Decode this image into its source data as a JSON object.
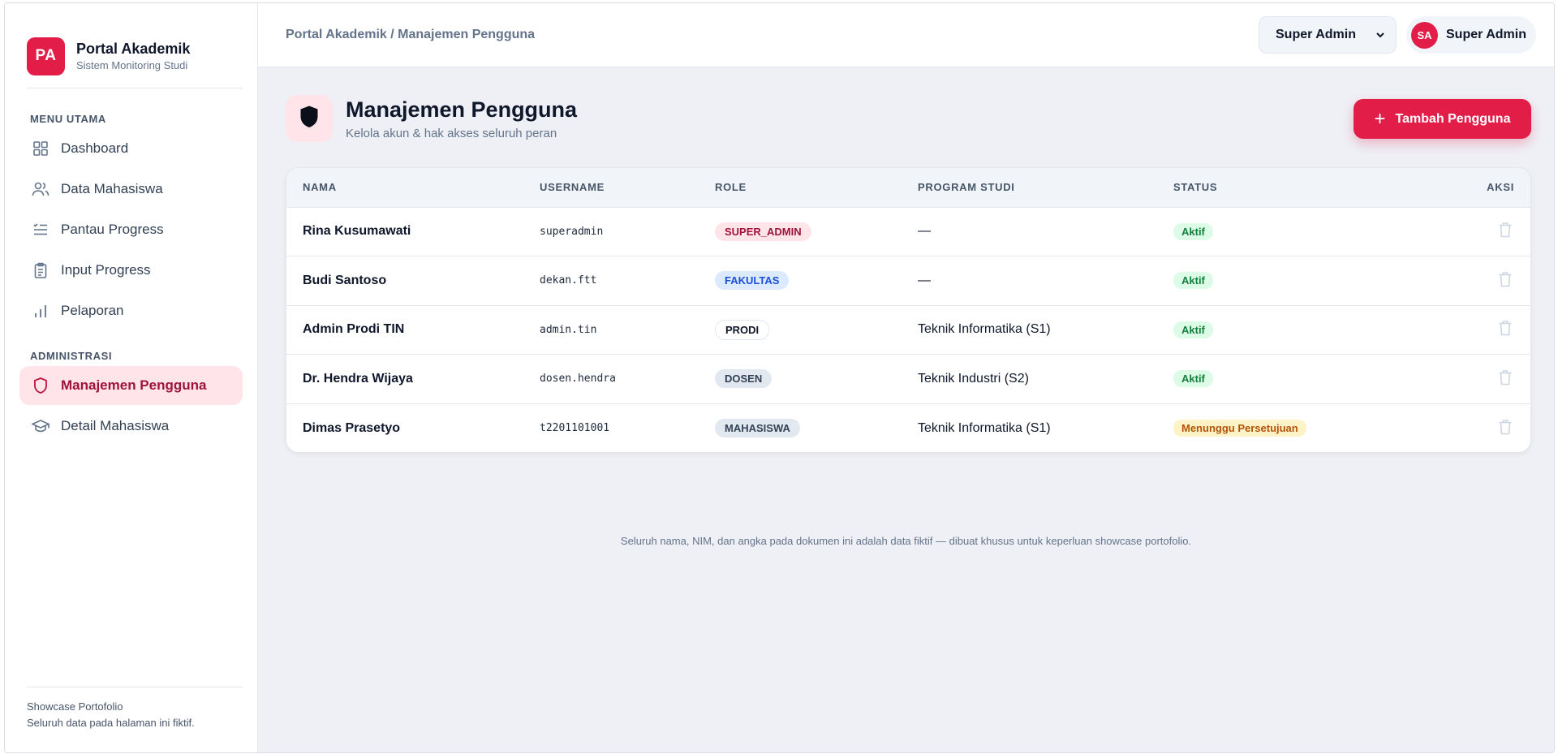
{
  "brand": {
    "logo": "PA",
    "title": "Portal Akademik",
    "subtitle": "Sistem Monitoring Studi"
  },
  "sidebar": {
    "section1": "MENU UTAMA",
    "items1": [
      {
        "label": "Dashboard",
        "icon": "grid-icon"
      },
      {
        "label": "Data Mahasiswa",
        "icon": "users-icon"
      },
      {
        "label": "Pantau Progress",
        "icon": "list-check-icon"
      },
      {
        "label": "Input Progress",
        "icon": "clipboard-icon"
      },
      {
        "label": "Pelaporan",
        "icon": "bar-chart-icon"
      }
    ],
    "section2": "ADMINISTRASI",
    "items2": [
      {
        "label": "Manajemen Pengguna",
        "icon": "shield-icon",
        "active": true
      },
      {
        "label": "Detail Mahasiswa",
        "icon": "graduation-cap-icon"
      }
    ],
    "footer_line1": "Showcase Portofolio",
    "footer_line2": "Seluruh data pada halaman ini fiktif."
  },
  "topbar": {
    "breadcrumb": "Portal Akademik / Manajemen Pengguna",
    "role_selected": "Super Admin",
    "avatar": "SA",
    "user_name": "Super Admin"
  },
  "page": {
    "title": "Manajemen Pengguna",
    "subtitle": "Kelola akun & hak akses seluruh peran",
    "add_button": "Tambah Pengguna"
  },
  "table": {
    "columns": [
      "NAMA",
      "USERNAME",
      "ROLE",
      "PROGRAM STUDI",
      "STATUS",
      "AKSI"
    ],
    "rows": [
      {
        "name": "Rina Kusumawati",
        "username": "superadmin",
        "role": "SUPER_ADMIN",
        "prodi": "—",
        "status": "Aktif"
      },
      {
        "name": "Budi Santoso",
        "username": "dekan.ftt",
        "role": "FAKULTAS",
        "prodi": "—",
        "status": "Aktif"
      },
      {
        "name": "Admin Prodi TIN",
        "username": "admin.tin",
        "role": "PRODI",
        "prodi": "Teknik Informatika (S1)",
        "status": "Aktif"
      },
      {
        "name": "Dr. Hendra Wijaya",
        "username": "dosen.hendra",
        "role": "DOSEN",
        "prodi": "Teknik Industri (S2)",
        "status": "Aktif"
      },
      {
        "name": "Dimas Prasetyo",
        "username": "t2201101001",
        "role": "MAHASISWA",
        "prodi": "Teknik Informatika (S1)",
        "status": "Menunggu Persetujuan"
      }
    ]
  },
  "disclaimer": "Seluruh nama, NIM, dan angka pada dokumen ini adalah data fiktif — dibuat khusus untuk keperluan showcase portofolio.",
  "colors": {
    "accent": "#e11d48",
    "active_bg": "#ffe4e9",
    "success": "#15803d",
    "warning": "#b45309"
  }
}
